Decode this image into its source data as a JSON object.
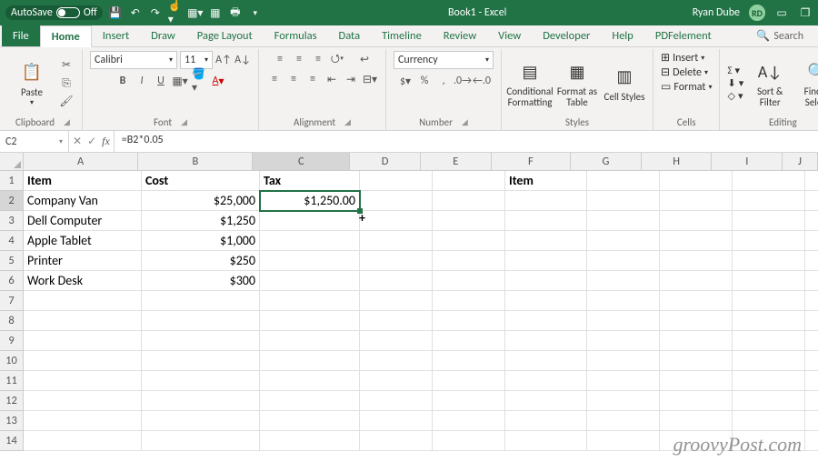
{
  "titlebar": {
    "autosave_label": "AutoSave",
    "autosave_state": "Off",
    "title": "Book1 - Excel",
    "user": "Ryan Dube",
    "user_initials": "RD"
  },
  "tabs": [
    "File",
    "Home",
    "Insert",
    "Draw",
    "Page Layout",
    "Formulas",
    "Data",
    "Timeline",
    "Review",
    "View",
    "Developer",
    "Help",
    "PDFelement"
  ],
  "active_tab": "Home",
  "search_placeholder": "Search",
  "ribbon": {
    "clipboard": {
      "label": "Clipboard",
      "paste": "Paste"
    },
    "font": {
      "label": "Font",
      "name": "Calibri",
      "size": "11"
    },
    "alignment": {
      "label": "Alignment"
    },
    "number": {
      "label": "Number",
      "format": "Currency"
    },
    "styles": {
      "label": "Styles",
      "cond": "Conditional Formatting",
      "fat": "Format as Table",
      "cs": "Cell Styles"
    },
    "cells": {
      "label": "Cells",
      "insert": "Insert",
      "delete": "Delete",
      "format": "Format"
    },
    "editing": {
      "label": "Editing",
      "sort": "Sort & Filter",
      "find": "Find & Select"
    }
  },
  "formula_bar": {
    "namebox": "C2",
    "formula": "=B2*0.05"
  },
  "columns": [
    "A",
    "B",
    "C",
    "D",
    "E",
    "F",
    "G",
    "H",
    "I",
    "J"
  ],
  "selected_col": "C",
  "selected_row": 2,
  "rows_visible": 14,
  "sheet": {
    "headers": {
      "A1": "Item",
      "B1": "Cost",
      "C1": "Tax",
      "F1": "Item"
    },
    "data": [
      {
        "A": "Company Van",
        "B": "$25,000",
        "C": "$1,250.00"
      },
      {
        "A": "Dell Computer",
        "B": "$1,250"
      },
      {
        "A": "Apple Tablet",
        "B": "$1,000"
      },
      {
        "A": "Printer",
        "B": "$250"
      },
      {
        "A": "Work Desk",
        "B": "$300"
      }
    ]
  },
  "watermark": "groovyPost.com"
}
